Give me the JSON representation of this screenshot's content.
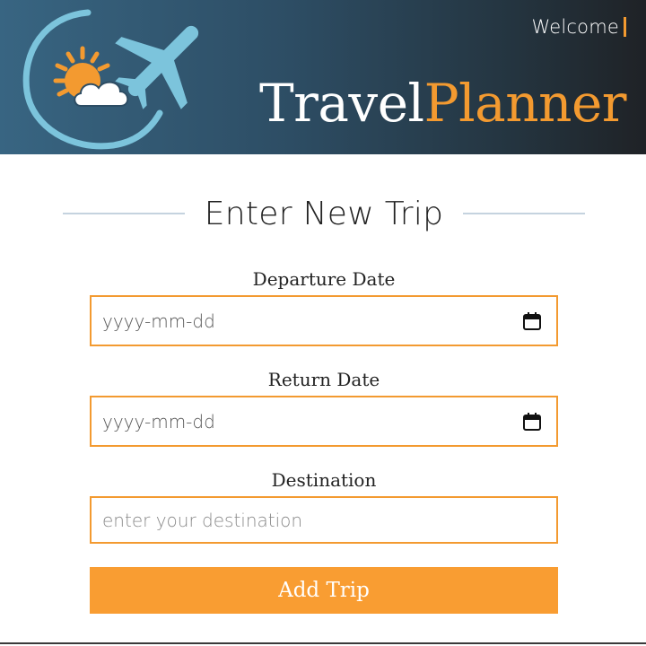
{
  "header": {
    "welcome_text": "Welcome",
    "brand_part1": "Travel",
    "brand_part2": "Planner",
    "logo_icon": "airplane-sun-cloud-logo"
  },
  "colors": {
    "accent": "#f39a30",
    "header_start": "#386582",
    "header_end": "#1f2226",
    "input_border": "#f39a30",
    "button_bg": "#f99d32",
    "logo_blue": "#7cc4dc"
  },
  "form": {
    "title": "Enter New Trip",
    "departure": {
      "label": "Departure Date",
      "value": "yyyy-mm-dd",
      "icon": "calendar-icon"
    },
    "return": {
      "label": "Return Date",
      "value": "yyyy-mm-dd",
      "icon": "calendar-icon"
    },
    "destination": {
      "label": "Destination",
      "placeholder": "enter your destination"
    },
    "submit_label": "Add Trip"
  }
}
